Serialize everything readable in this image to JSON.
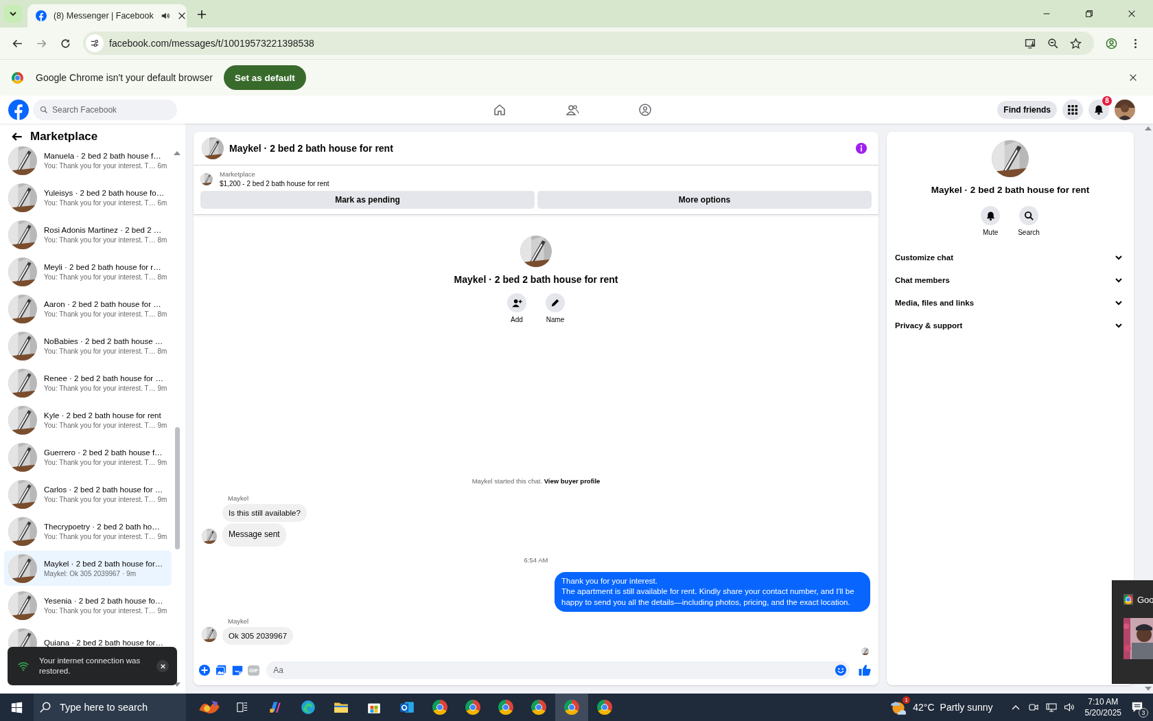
{
  "browser": {
    "tab_title": "(8) Messenger | Facebook",
    "url": "facebook.com/messages/t/10019573221398538",
    "infobar_text": "Google Chrome isn't your default browser",
    "infobar_button": "Set as default"
  },
  "facebook": {
    "search_placeholder": "Search Facebook",
    "nav": [
      {
        "kind": "home"
      },
      {
        "kind": "friends"
      },
      {
        "kind": "groups"
      }
    ],
    "find_friends": "Find friends",
    "notification_count": "8"
  },
  "sidebar": {
    "title": "Marketplace",
    "chats": [
      {
        "title": "Manuela · 2 bed 2 bath house f…",
        "preview": "You: Thank you for your interest. T… 6m",
        "selected": false
      },
      {
        "title": "Yuleisys · 2 bed 2 bath house fo…",
        "preview": "You: Thank you for your interest. T… 6m",
        "selected": false
      },
      {
        "title": "Rosi Adonis Martinez · 2 bed 2 …",
        "preview": "You: Thank you for your interest. T… 8m",
        "selected": false
      },
      {
        "title": "Meyli · 2 bed 2 bath house for r…",
        "preview": "You: Thank you for your interest. T… 8m",
        "selected": false
      },
      {
        "title": "Aaron · 2 bed 2 bath house for …",
        "preview": "You: Thank you for your interest. T… 8m",
        "selected": false
      },
      {
        "title": "NoBabies · 2 bed 2 bath house …",
        "preview": "You: Thank you for your interest. T… 8m",
        "selected": false
      },
      {
        "title": "Renee · 2 bed 2 bath house for …",
        "preview": "You: Thank you for your interest. T… 9m",
        "selected": false
      },
      {
        "title": "Kyle · 2 bed 2 bath house for rent",
        "preview": "You: Thank you for your interest. T… 9m",
        "selected": false
      },
      {
        "title": "Guerrero · 2 bed 2 bath house f…",
        "preview": "You: Thank you for your interest. T… 9m",
        "selected": false
      },
      {
        "title": "Carlos · 2 bed 2 bath house for …",
        "preview": "You: Thank you for your interest. T… 9m",
        "selected": false
      },
      {
        "title": "Thecrypoetry · 2 bed 2 bath ho…",
        "preview": "You: Thank you for your interest. T… 9m",
        "selected": false
      },
      {
        "title": "Maykel · 2 bed 2 bath house for…",
        "preview": "Maykel: Ok 305 2039967 · 9m",
        "selected": true
      },
      {
        "title": "Yesenia · 2 bed 2 bath house fo…",
        "preview": "You: Thank you for your interest. T… 9m",
        "selected": false
      },
      {
        "title": "Quiana · 2 bed 2 bath house for…",
        "selected": false
      }
    ]
  },
  "conversation": {
    "title": "Maykel · 2 bed 2 bath house for rent",
    "listing": {
      "source": "Marketplace",
      "item": "$1,200 - 2 bed 2 bath house for rent"
    },
    "actions": [
      "Mark as pending",
      "More options"
    ],
    "intro": {
      "name": "Maykel · 2 bed 2 bath house for rent",
      "actions": [
        {
          "kind": "add",
          "label": "Add"
        },
        {
          "kind": "name",
          "label": "Name"
        }
      ]
    },
    "messages": [
      {
        "kind": "system",
        "text": "Maykel started this chat.",
        "link": "View buyer profile"
      },
      {
        "kind": "incoming",
        "sender": "Maykel",
        "bubbles": [
          "Is this still available?",
          "Message sent"
        ]
      },
      {
        "kind": "time",
        "text": "6:54 AM"
      },
      {
        "kind": "outgoing",
        "bubbles": [
          "Thank you for your interest.\nThe apartment is still available for rent. Kindly share your contact number, and I'll be happy to send you all the details—including photos, pricing, and the exact location."
        ]
      },
      {
        "kind": "incoming",
        "sender": "Maykel",
        "bubbles": [
          "Ok 305 2039967"
        ]
      },
      {
        "kind": "seen"
      }
    ],
    "composer": {
      "gif_label": "GIF",
      "placeholder": "Aa"
    }
  },
  "details": {
    "name": "Maykel · 2 bed 2 bath house for rent",
    "actions": [
      {
        "kind": "mute",
        "label": "Mute"
      },
      {
        "kind": "search",
        "label": "Search"
      }
    ],
    "sections": [
      "Customize chat",
      "Chat members",
      "Media, files and links",
      "Privacy & support"
    ]
  },
  "toast": {
    "text": "Your internet connection was restored."
  },
  "popup": {
    "app_label": "Goo"
  },
  "taskbar": {
    "search_placeholder": "Type here to search",
    "apps": [
      {
        "kind": "widget",
        "selected": false
      },
      {
        "kind": "taskview",
        "selected": false
      },
      {
        "kind": "assistant",
        "selected": false
      },
      {
        "kind": "edge",
        "selected": false
      },
      {
        "kind": "files",
        "selected": false
      },
      {
        "kind": "store",
        "selected": false
      },
      {
        "kind": "mail",
        "selected": false
      },
      {
        "kind": "browser",
        "selected": false
      },
      {
        "kind": "browser",
        "selected": false
      },
      {
        "kind": "browser",
        "selected": false
      },
      {
        "kind": "browser",
        "selected": false
      },
      {
        "kind": "browser",
        "selected": true
      },
      {
        "kind": "browser",
        "selected": false
      }
    ],
    "weather": {
      "badge": "1",
      "temperature": "42°C",
      "condition": "Partly sunny"
    },
    "time": "7:10 AM",
    "date": "5/20/2025",
    "notifications": "3"
  }
}
